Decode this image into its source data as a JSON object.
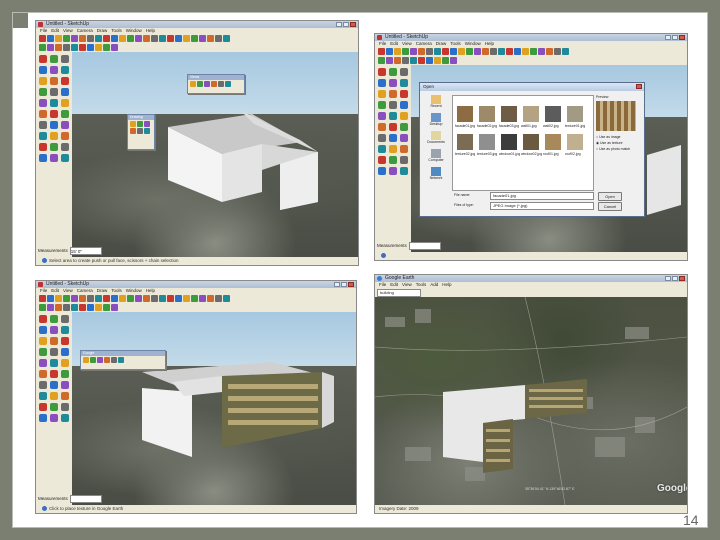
{
  "slide": {
    "number": "14",
    "colors": {
      "background": "#7b7f72",
      "frame": "#ffffff"
    }
  },
  "panels": [
    {
      "id": "sketchup-1",
      "title": "Untitled - SketchUp",
      "menu": [
        "File",
        "Edit",
        "View",
        "Camera",
        "Draw",
        "Tools",
        "Window",
        "Help"
      ],
      "status_text": "Select area to create push or pull face, scissors + chain selection",
      "vcc_label": "Measurements",
      "vcc_value": "15' 0\"",
      "floating_palettes": [
        "Views",
        "Drawing"
      ]
    },
    {
      "id": "sketchup-2",
      "title": "Untitled - SketchUp",
      "menu": [
        "File",
        "Edit",
        "View",
        "Camera",
        "Draw",
        "Tools",
        "Window",
        "Help"
      ],
      "vcc_label": "Measurements",
      "dialog": {
        "title": "Open",
        "sidebar": [
          "Recent",
          "Desktop",
          "Documents",
          "Computer",
          "Network"
        ],
        "files": [
          "facade01.jpg",
          "facade02.jpg",
          "facade03.jpg",
          "wall01.jpg",
          "wall02.jpg",
          "texture01.jpg",
          "texture02.jpg",
          "texture03.jpg",
          "window01.jpg",
          "window02.jpg",
          "roof01.jpg",
          "roof02.jpg"
        ],
        "filename_label": "File name:",
        "filename_value": "facade01.jpg",
        "filetype_label": "Files of type:",
        "filetype_value": "JPEG Image (*.jpg)",
        "open_label": "Open",
        "cancel_label": "Cancel",
        "preview_label": "Preview",
        "options": [
          "Use as image",
          "Use as texture",
          "Use as photo match"
        ]
      }
    },
    {
      "id": "sketchup-3",
      "title": "Untitled - SketchUp",
      "menu": [
        "File",
        "Edit",
        "View",
        "Camera",
        "Draw",
        "Tools",
        "Window",
        "Help"
      ],
      "status_text": "Click to place texture in Google Earth",
      "vcc_label": "Measurements",
      "floating_palettes": [
        "Google"
      ]
    },
    {
      "id": "google-earth",
      "title": "Google Earth",
      "menu": [
        "File",
        "Edit",
        "View",
        "Tools",
        "Add",
        "Help"
      ],
      "search_value": "building",
      "logo": "Google",
      "coordinate_text": "35°36'04.41\" N  139°46'52.87\" E",
      "status_text": "Imagery Date: 2009"
    }
  ],
  "toolbar_icons": [
    "select-icon",
    "eraser-icon",
    "paint-icon",
    "line-icon",
    "arc-icon",
    "rectangle-icon",
    "circle-icon",
    "polygon-icon",
    "move-icon",
    "pushpull-icon",
    "rotate-icon",
    "followme-icon",
    "scale-icon",
    "offset-icon",
    "tape-icon",
    "dimension-icon",
    "protractor-icon",
    "text-icon",
    "axes-icon",
    "orbit-icon",
    "pan-icon",
    "zoom-icon",
    "zoom-extents-icon",
    "camera-icon"
  ]
}
